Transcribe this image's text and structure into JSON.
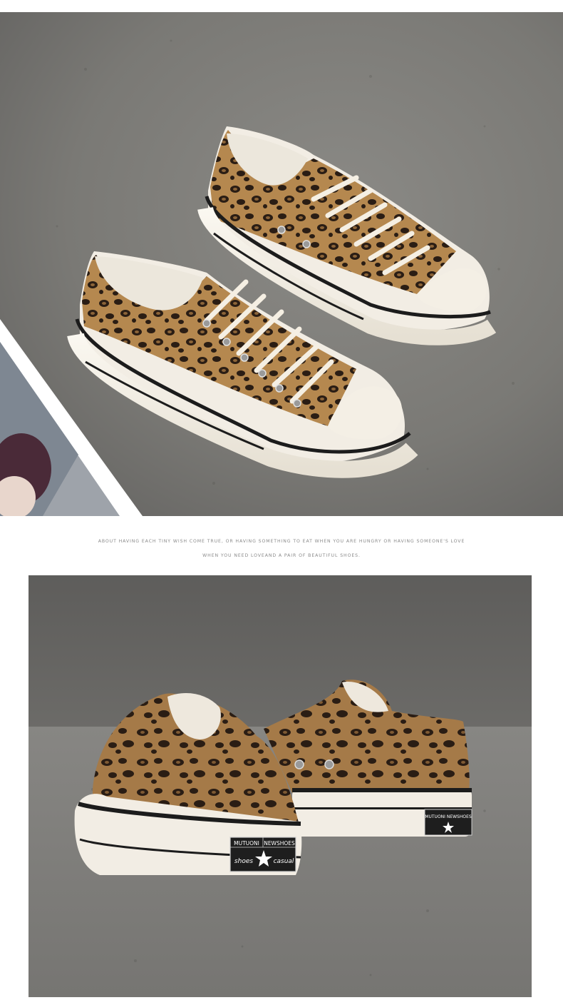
{
  "caption": {
    "line1": "ABOUT HAVING EACH TINY WISH COME TRUE, OR HAVING SOMETHING TO EAT WHEN YOU ARE HUNGRY OR HAVING SOMEONE'S LOVE",
    "line2": "WHEN YOU NEED LOVEAND A PAIR OF BEAUTIFUL SHOES."
  },
  "heel_label": {
    "top_left": "MUTUONI",
    "top_right": "NEWSHOES",
    "bottom_left": "shoes",
    "bottom_right": "casual"
  },
  "colors": {
    "concrete": "#7d7c79",
    "leopard_base": "#b08450",
    "leopard_spot": "#2a1d14",
    "sole": "#f1ece2",
    "sole_stripe": "#1c1c1c"
  }
}
